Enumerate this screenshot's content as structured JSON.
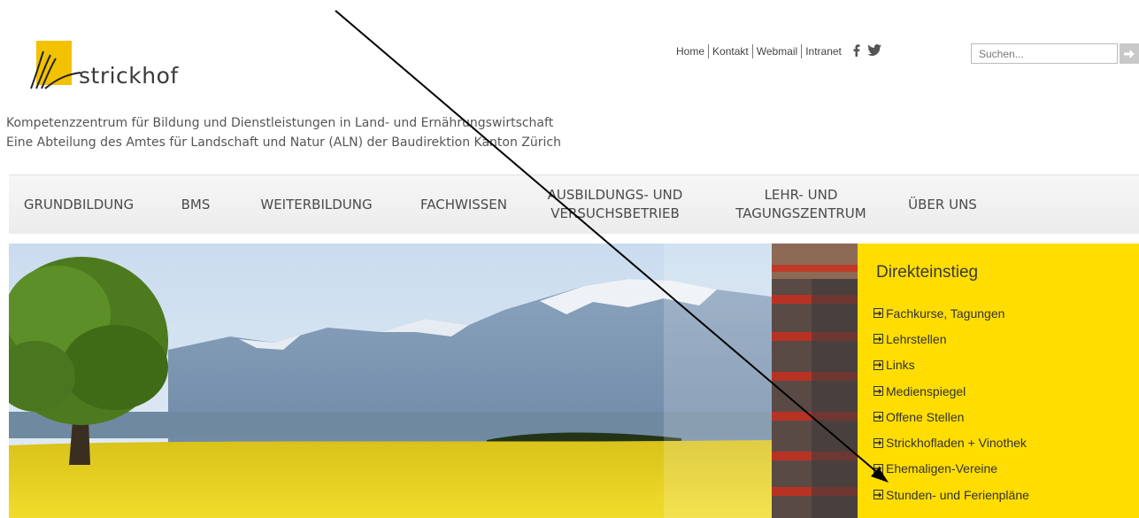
{
  "logo": {
    "name": "strickhof",
    "mark_color": "#f2c200"
  },
  "tagline": {
    "line1": "Kompetenzzentrum für Bildung und Dienstleistungen in Land- und Ernährungswirtschaft",
    "line2": "Eine Abteilung des Amtes für Landschaft und Natur (ALN) der Baudirektion Kanton Zürich"
  },
  "toplinks": [
    "Home",
    "Kontakt",
    "Webmail",
    "Intranet"
  ],
  "social_icons": [
    "facebook-icon",
    "twitter-icon"
  ],
  "search": {
    "placeholder": "Suchen...",
    "button_icon": "arrow-right-icon"
  },
  "nav": {
    "items": [
      {
        "line1": "GRUNDBILDUNG",
        "line2": ""
      },
      {
        "line1": "BMS",
        "line2": ""
      },
      {
        "line1": "WEITERBILDUNG",
        "line2": ""
      },
      {
        "line1": "FACHWISSEN",
        "line2": ""
      },
      {
        "line1": "AUSBILDUNGS- UND",
        "line2": "VERSUCHSBETRIEB"
      },
      {
        "line1": "LEHR- UND",
        "line2": "TAGUNGSZENTRUM"
      },
      {
        "line1": "ÜBER UNS",
        "line2": ""
      }
    ]
  },
  "direkteinstieg": {
    "title": "Direkteinstieg",
    "items": [
      "Fachkurse, Tagungen",
      "Lehrstellen",
      "Links",
      "Medienspiegel",
      "Offene Stellen",
      "Strickhofladen + Vinothek",
      "Ehemaligen-Vereine",
      "Stunden- und Ferienpläne"
    ],
    "background": "#ffdd00"
  }
}
